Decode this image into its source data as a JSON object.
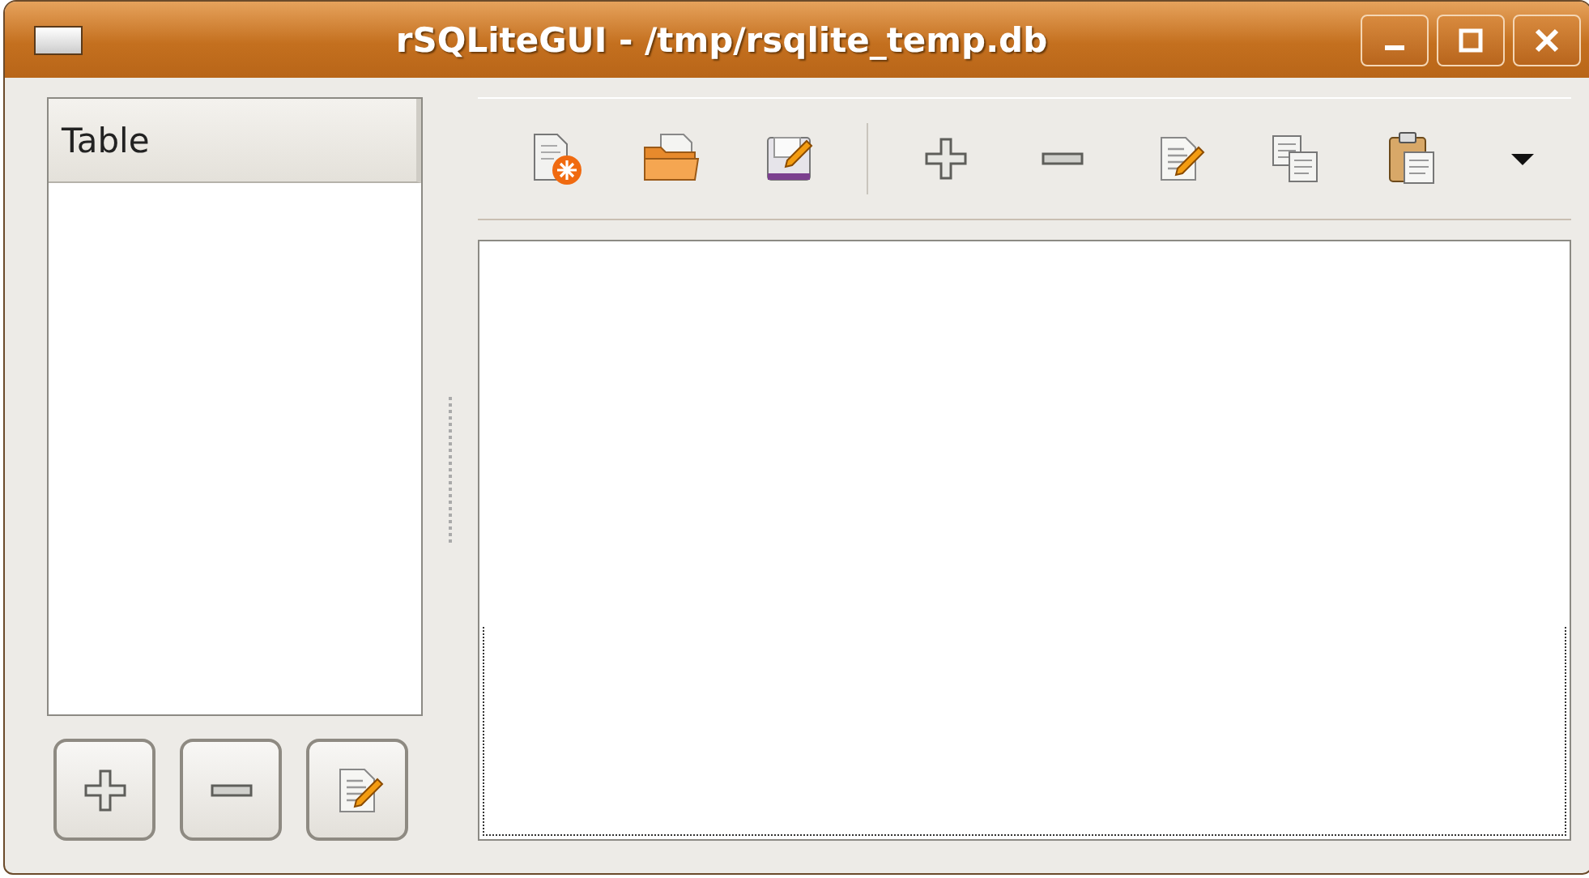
{
  "window": {
    "title": "rSQLiteGUI - /tmp/rsqlite_temp.db"
  },
  "table_list": {
    "columns": [
      "Table"
    ]
  },
  "list_buttons": [
    {
      "kind": "add"
    },
    {
      "kind": "remove"
    },
    {
      "kind": "edit"
    }
  ],
  "toolbar": [
    {
      "kind": "new"
    },
    {
      "kind": "open"
    },
    {
      "kind": "save"
    },
    {
      "kind": "separator"
    },
    {
      "kind": "add"
    },
    {
      "kind": "remove"
    },
    {
      "kind": "edit"
    },
    {
      "kind": "copy"
    },
    {
      "kind": "paste"
    },
    {
      "kind": "more"
    }
  ]
}
